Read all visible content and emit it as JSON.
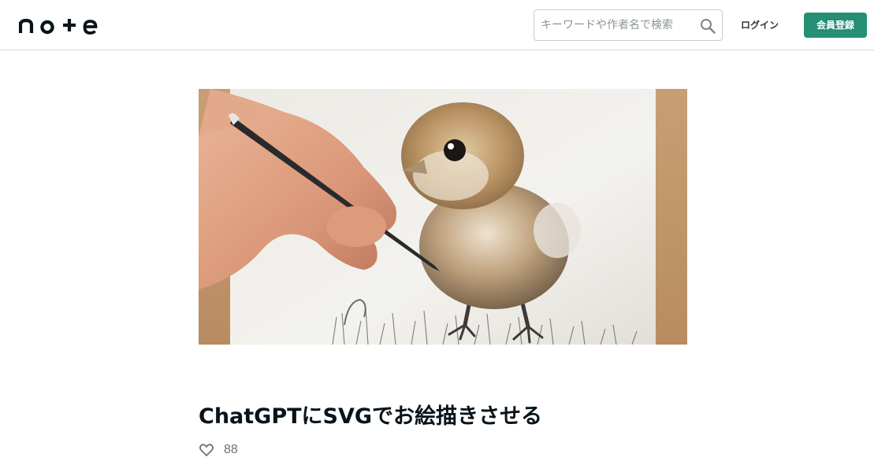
{
  "header": {
    "logo_text": "note",
    "search": {
      "placeholder": "キーワードや作者名で検索",
      "value": ""
    },
    "login_label": "ログイン",
    "signup_label": "会員登録"
  },
  "article": {
    "hero_image": {
      "subject": "hand drawing a fluffy chick with a pencil"
    },
    "title": "ChatGPTにSVGでお絵描きさせる",
    "like_count": "88"
  },
  "icons": {
    "search": "search-icon",
    "like": "heart-icon"
  },
  "colors": {
    "accent": "#248f74",
    "text": "#08131a",
    "muted": "#6b7378"
  }
}
